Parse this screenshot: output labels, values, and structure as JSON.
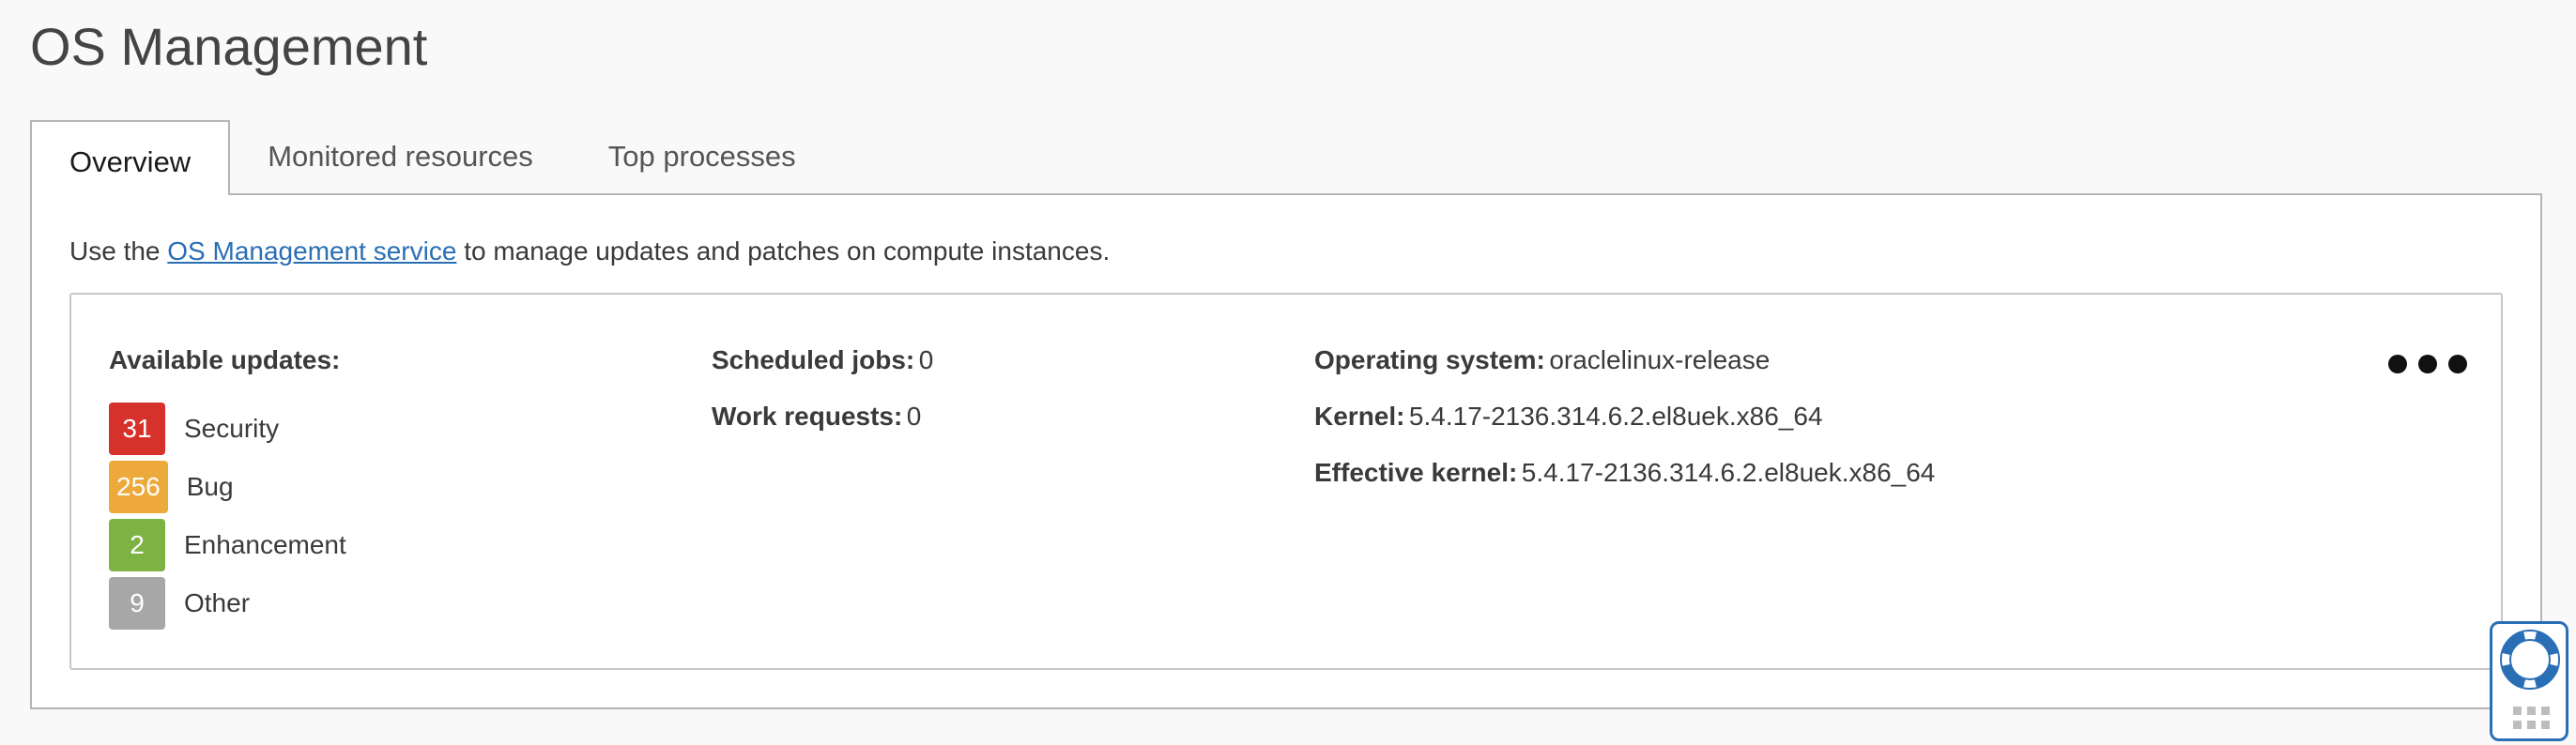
{
  "page": {
    "title": "OS Management"
  },
  "tabs": [
    {
      "label": "Overview",
      "active": true
    },
    {
      "label": "Monitored resources",
      "active": false
    },
    {
      "label": "Top processes",
      "active": false
    }
  ],
  "intro": {
    "prefix": "Use the ",
    "link": "OS Management service",
    "suffix": " to manage updates and patches on compute instances."
  },
  "updates": {
    "label": "Available updates:",
    "items": [
      {
        "count": "31",
        "name": "Security",
        "color": "#d6312b"
      },
      {
        "count": "256",
        "name": "Bug",
        "color": "#eda93a"
      },
      {
        "count": "2",
        "name": "Enhancement",
        "color": "#7cb342"
      },
      {
        "count": "9",
        "name": "Other",
        "color": "#a7a7a7"
      }
    ]
  },
  "jobs": {
    "scheduled_label": "Scheduled jobs:",
    "scheduled_value": "0",
    "work_label": "Work requests:",
    "work_value": "0"
  },
  "system": {
    "os_label": "Operating system:",
    "os_value": "oraclelinux-release",
    "kernel_label": "Kernel:",
    "kernel_value": "5.4.17-2136.314.6.2.el8uek.x86_64",
    "eff_label": "Effective kernel:",
    "eff_value": "5.4.17-2136.314.6.2.el8uek.x86_64"
  },
  "icons": {
    "more": "more-actions-icon",
    "help": "lifebuoy-icon"
  },
  "colors": {
    "accent": "#2a6fb6"
  }
}
